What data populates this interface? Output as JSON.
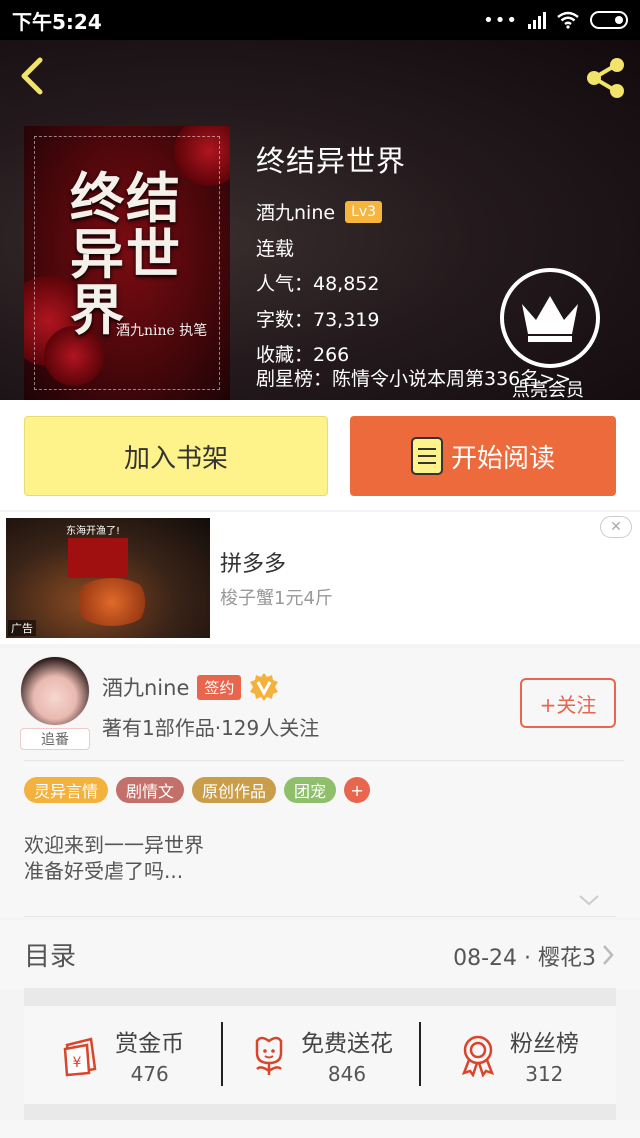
{
  "status_bar": {
    "time": "下午5:24"
  },
  "book": {
    "title": "终结异世界",
    "author": "酒九nine",
    "level": "Lv3",
    "status": "连载",
    "popularity": "人气：48,852",
    "word_count": "字数：73,319",
    "favorites": "收藏：266",
    "ranking": "剧星榜：陈情令小说本周第336名>>",
    "vip_label": "点亮会员"
  },
  "cover": {
    "title_chars": "终结异世界",
    "author_sign": "酒九nine 执笔"
  },
  "actions": {
    "add_shelf": "加入书架",
    "start_reading": "开始阅读"
  },
  "ad": {
    "name": "拼多多",
    "description": "梭子蟹1元4斤",
    "tag": "广告",
    "banner": "东海开渔了!"
  },
  "author_card": {
    "name": "酒九nine",
    "signed": "签约",
    "stats": "著有1部作品·129人关注",
    "follow": "+关注",
    "avatar_badge": "追番",
    "tags": [
      {
        "label": "灵异言情",
        "color": "#f3b23e"
      },
      {
        "label": "剧情文",
        "color": "#c4706a"
      },
      {
        "label": "原创作品",
        "color": "#c99d4a"
      },
      {
        "label": "团宠",
        "color": "#8fbf6a"
      }
    ],
    "tag_more": "+",
    "intro_line1": "欢迎来到一一异世界",
    "intro_line2": "准备好受虐了吗..."
  },
  "toc": {
    "label": "目录",
    "latest": "08-24 · 樱花3"
  },
  "stats": [
    {
      "label": "赏金币",
      "value": "476",
      "icon": "coin-envelope-icon"
    },
    {
      "label": "免费送花",
      "value": "846",
      "icon": "flower-icon"
    },
    {
      "label": "粉丝榜",
      "value": "312",
      "icon": "medal-icon"
    }
  ],
  "colors": {
    "accent": "#ec6a3c",
    "shelf": "#fef38a",
    "icon_red": "#d9442a"
  }
}
